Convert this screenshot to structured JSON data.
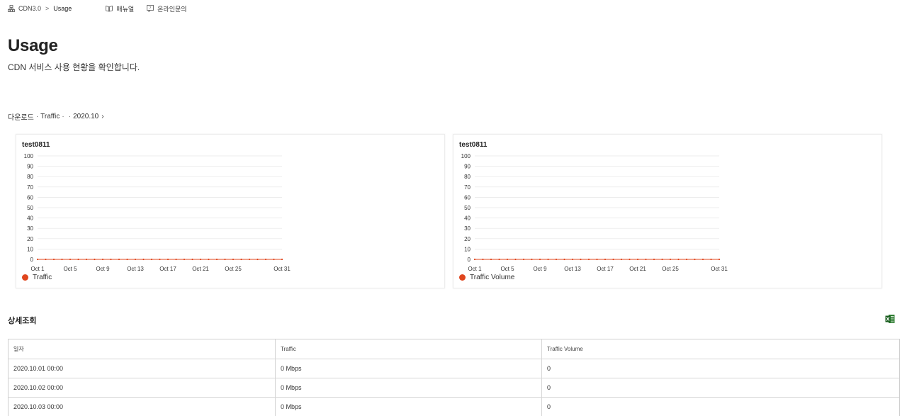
{
  "breadcrumb": {
    "root": "CDN3.0",
    "separator": ">",
    "current": "Usage"
  },
  "toplinks": {
    "manual": "매뉴얼",
    "inquiry": "온라인문의"
  },
  "page": {
    "title": "Usage",
    "subtitle": "CDN 서비스 사용 현황을 확인합니다."
  },
  "filter": {
    "parts": [
      "다운로드",
      "Traffic",
      "",
      "2020.10"
    ],
    "separator": "·",
    "chevron": "›"
  },
  "section": {
    "title": "상세조회"
  },
  "colors": {
    "series": "#e0461e",
    "grid": "#e6e6e6"
  },
  "icons": {
    "breadcrumb": "sitemap-icon",
    "manual": "book-icon",
    "inquiry": "chat-icon",
    "excel": "excel-icon"
  },
  "table": {
    "headers": [
      "일자",
      "Traffic",
      "Traffic Volume"
    ],
    "rows": [
      [
        "2020.10.01 00:00",
        "0 Mbps",
        "0"
      ],
      [
        "2020.10.02 00:00",
        "0 Mbps",
        "0"
      ],
      [
        "2020.10.03 00:00",
        "0 Mbps",
        "0"
      ]
    ]
  },
  "chart_data": [
    {
      "type": "line",
      "title": "test0811",
      "xlabel": "",
      "ylabel": "",
      "ylim": [
        0,
        100
      ],
      "yticks": [
        0,
        10,
        20,
        30,
        40,
        50,
        60,
        70,
        80,
        90,
        100
      ],
      "xtick_labels": [
        "Oct 1",
        "Oct 5",
        "Oct 9",
        "Oct 13",
        "Oct 17",
        "Oct 21",
        "Oct 25",
        "Oct 31"
      ],
      "xtick_days": [
        1,
        5,
        9,
        13,
        17,
        21,
        25,
        31
      ],
      "grid": true,
      "legend": "bottom-left",
      "series": [
        {
          "name": "Traffic",
          "x": [
            1,
            2,
            3,
            4,
            5,
            6,
            7,
            8,
            9,
            10,
            11,
            12,
            13,
            14,
            15,
            16,
            17,
            18,
            19,
            20,
            21,
            22,
            23,
            24,
            25,
            26,
            27,
            28,
            29,
            30,
            31
          ],
          "values": [
            0,
            0,
            0,
            0,
            0,
            0,
            0,
            0,
            0,
            0,
            0,
            0,
            0,
            0,
            0,
            0,
            0,
            0,
            0,
            0,
            0,
            0,
            0,
            0,
            0,
            0,
            0,
            0,
            0,
            0,
            0
          ]
        }
      ]
    },
    {
      "type": "line",
      "title": "test0811",
      "xlabel": "",
      "ylabel": "",
      "ylim": [
        0,
        100
      ],
      "yticks": [
        0,
        10,
        20,
        30,
        40,
        50,
        60,
        70,
        80,
        90,
        100
      ],
      "xtick_labels": [
        "Oct 1",
        "Oct 5",
        "Oct 9",
        "Oct 13",
        "Oct 17",
        "Oct 21",
        "Oct 25",
        "Oct 31"
      ],
      "xtick_days": [
        1,
        5,
        9,
        13,
        17,
        21,
        25,
        31
      ],
      "grid": true,
      "legend": "bottom-left",
      "series": [
        {
          "name": "Traffic Volume",
          "x": [
            1,
            2,
            3,
            4,
            5,
            6,
            7,
            8,
            9,
            10,
            11,
            12,
            13,
            14,
            15,
            16,
            17,
            18,
            19,
            20,
            21,
            22,
            23,
            24,
            25,
            26,
            27,
            28,
            29,
            30,
            31
          ],
          "values": [
            0,
            0,
            0,
            0,
            0,
            0,
            0,
            0,
            0,
            0,
            0,
            0,
            0,
            0,
            0,
            0,
            0,
            0,
            0,
            0,
            0,
            0,
            0,
            0,
            0,
            0,
            0,
            0,
            0,
            0,
            0
          ]
        }
      ]
    }
  ]
}
